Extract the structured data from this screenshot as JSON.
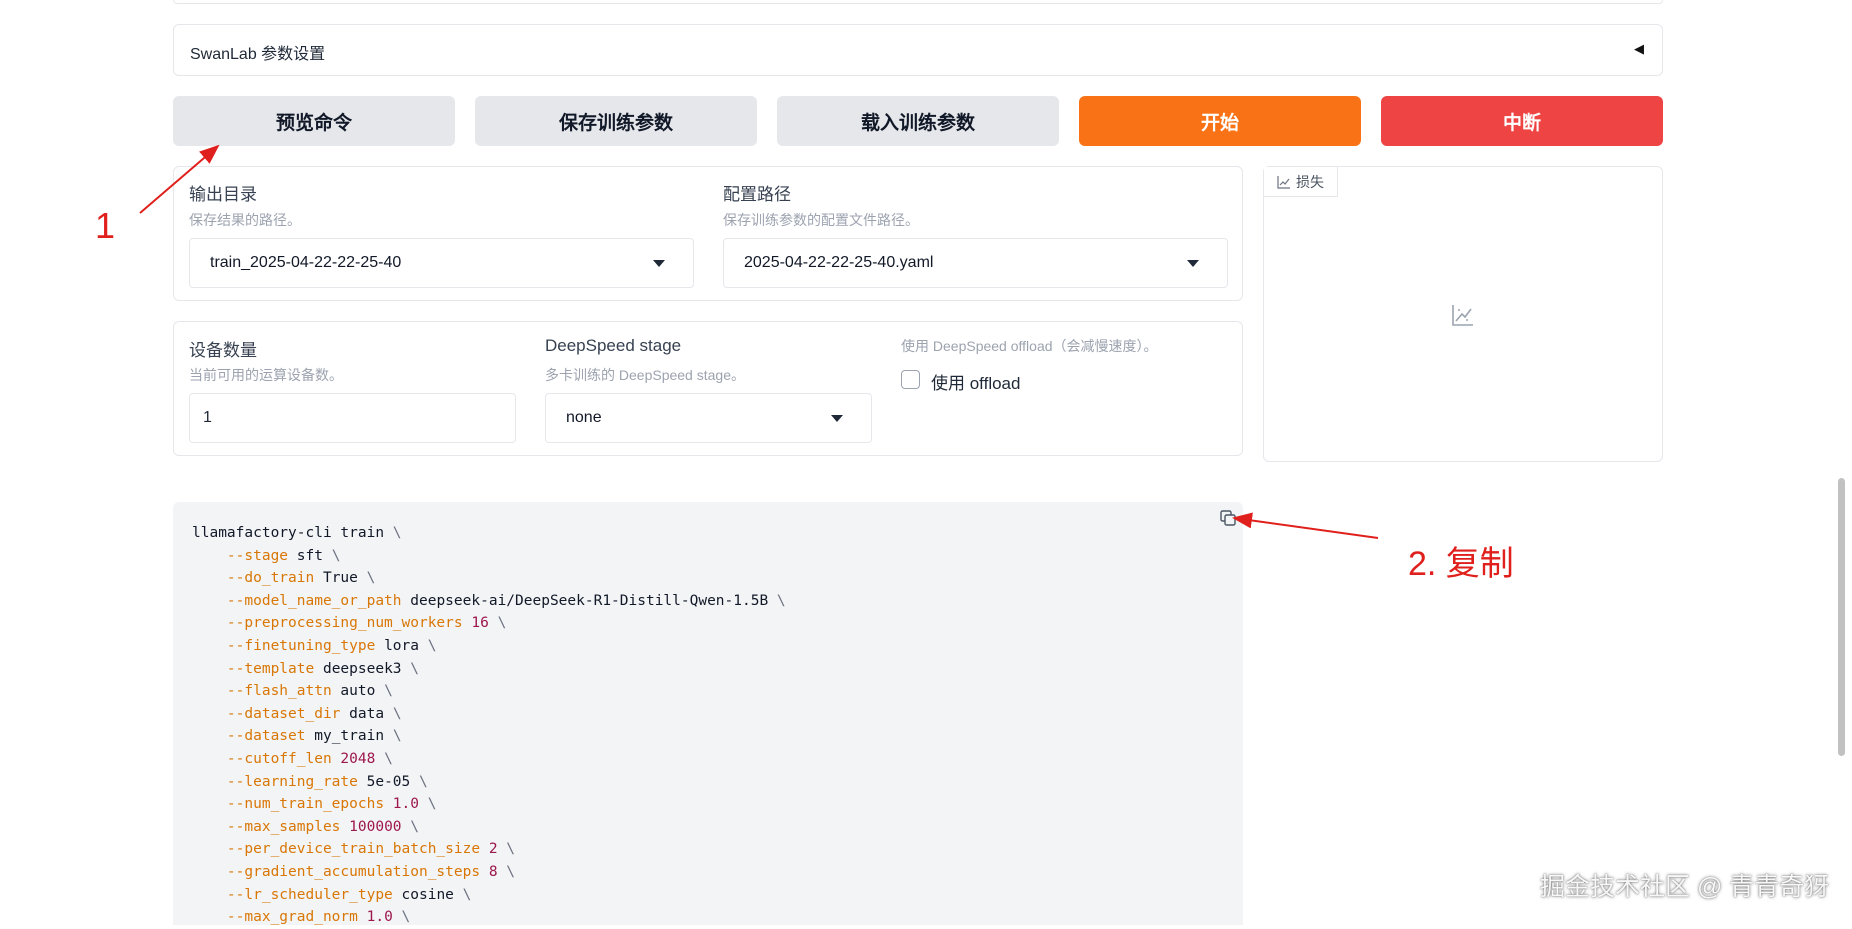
{
  "accordion": {
    "label": "SwanLab 参数设置"
  },
  "actions": {
    "preview_label": "预览命令",
    "save_label": "保存训练参数",
    "load_label": "载入训练参数",
    "start_label": "开始",
    "abort_label": "中断"
  },
  "output": {
    "dir_label": "输出目录",
    "dir_info": "保存结果的路径。",
    "dir_value": "train_2025-04-22-22-25-40",
    "config_label": "配置路径",
    "config_info": "保存训练参数的配置文件路径。",
    "config_value": "2025-04-22-22-25-40.yaml"
  },
  "devices": {
    "count_label": "设备数量",
    "count_info": "当前可用的运算设备数。",
    "count_value": "1",
    "ds_stage_label": "DeepSpeed stage",
    "ds_stage_info": "多卡训练的 DeepSpeed stage。",
    "ds_stage_value": "none",
    "offload_info": "使用 DeepSpeed offload（会减慢速度）。",
    "offload_label": "使用 offload",
    "offload_checked": false
  },
  "plot": {
    "tab_label": "损失"
  },
  "command": {
    "lines": [
      {
        "flag": "",
        "value": "llamafactory-cli train",
        "kind": "text"
      },
      {
        "flag": "--stage",
        "value": "sft",
        "kind": "text"
      },
      {
        "flag": "--do_train",
        "value": "True",
        "kind": "text"
      },
      {
        "flag": "--model_name_or_path",
        "value": "deepseek-ai/DeepSeek-R1-Distill-Qwen-1.5B",
        "kind": "text"
      },
      {
        "flag": "--preprocessing_num_workers",
        "value": "16",
        "kind": "num"
      },
      {
        "flag": "--finetuning_type",
        "value": "lora",
        "kind": "text"
      },
      {
        "flag": "--template",
        "value": "deepseek3",
        "kind": "text"
      },
      {
        "flag": "--flash_attn",
        "value": "auto",
        "kind": "text"
      },
      {
        "flag": "--dataset_dir",
        "value": "data",
        "kind": "text"
      },
      {
        "flag": "--dataset",
        "value": "my_train",
        "kind": "text"
      },
      {
        "flag": "--cutoff_len",
        "value": "2048",
        "kind": "num"
      },
      {
        "flag": "--learning_rate",
        "value": "5e-05",
        "kind": "text"
      },
      {
        "flag": "--num_train_epochs",
        "value": "1.0",
        "kind": "num"
      },
      {
        "flag": "--max_samples",
        "value": "100000",
        "kind": "num"
      },
      {
        "flag": "--per_device_train_batch_size",
        "value": "2",
        "kind": "num"
      },
      {
        "flag": "--gradient_accumulation_steps",
        "value": "8",
        "kind": "num"
      },
      {
        "flag": "--lr_scheduler_type",
        "value": "cosine",
        "kind": "text"
      },
      {
        "flag": "--max_grad_norm",
        "value": "1.0",
        "kind": "num"
      }
    ]
  },
  "annotations": {
    "one": "1",
    "two": "2. 复制"
  },
  "watermark": "掘金技术社区 @ 青青奇犽",
  "colors": {
    "start": "#f97316",
    "abort": "#ef4444",
    "annotation": "#e0201c",
    "flag": "#d97706",
    "number": "#9d174d"
  }
}
